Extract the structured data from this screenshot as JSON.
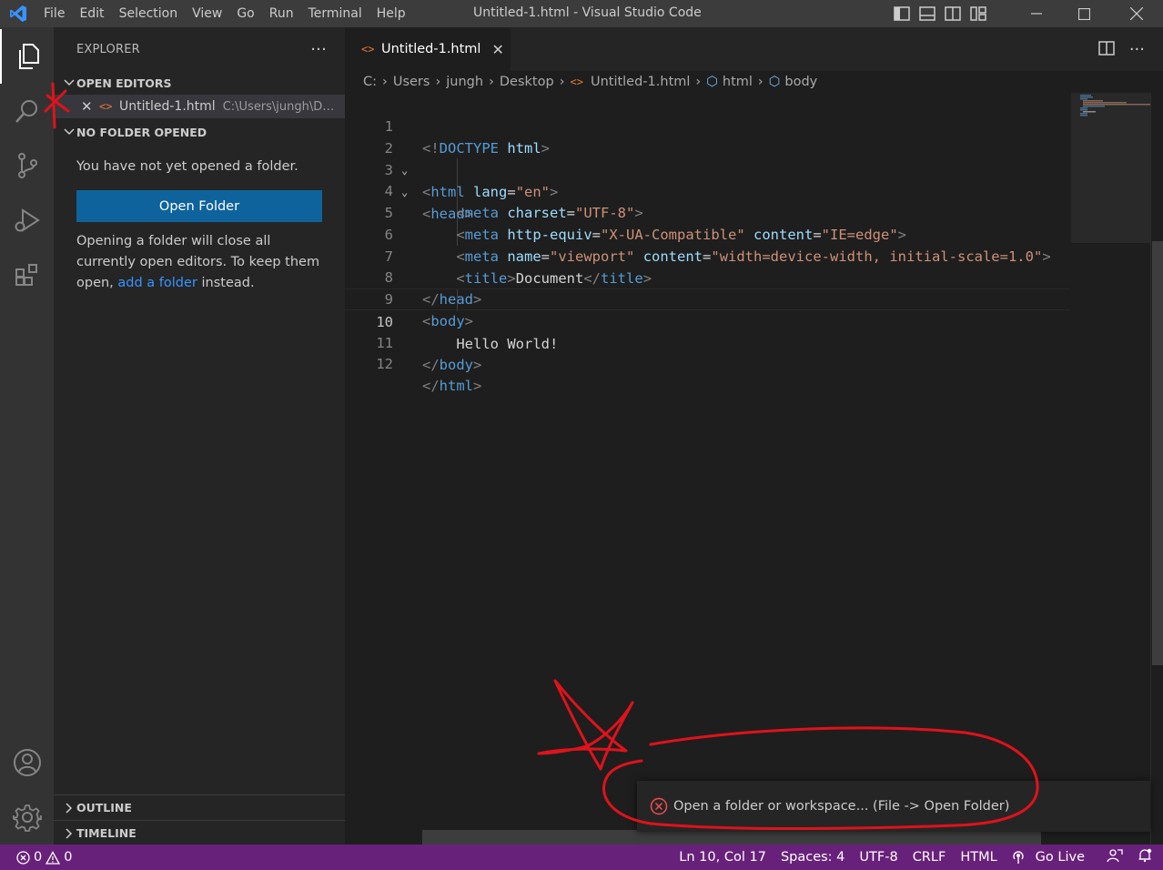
{
  "window": {
    "title": "Untitled-1.html - Visual Studio Code",
    "menu": [
      "File",
      "Edit",
      "Selection",
      "View",
      "Go",
      "Run",
      "Terminal",
      "Help"
    ]
  },
  "sidebar": {
    "title": "EXPLORER",
    "more": "···",
    "open_editors": {
      "label": "OPEN EDITORS",
      "file_name": "Untitled-1.html",
      "file_path": "C:\\Users\\jungh\\Desktop"
    },
    "no_folder": {
      "label": "NO FOLDER OPENED",
      "message": "You have not yet opened a folder.",
      "button": "Open Folder",
      "info_prefix": "Opening a folder will close all currently open editors. To keep them open,",
      "info_link": "add a folder",
      "info_suffix": "instead."
    },
    "outline": "OUTLINE",
    "timeline": "TIMELINE"
  },
  "editor": {
    "tab_label": "Untitled-1.html",
    "breadcrumb": [
      "C:",
      "Users",
      "jungh",
      "Desktop",
      "Untitled-1.html",
      "html",
      "body"
    ],
    "current_line": 10,
    "lines": [
      {
        "n": "1"
      },
      {
        "n": "2"
      },
      {
        "n": "3"
      },
      {
        "n": "4"
      },
      {
        "n": "5"
      },
      {
        "n": "6"
      },
      {
        "n": "7"
      },
      {
        "n": "8"
      },
      {
        "n": "9"
      },
      {
        "n": "10"
      },
      {
        "n": "11"
      },
      {
        "n": "12"
      }
    ]
  },
  "notification": {
    "message": "Open a folder or workspace... (File -> Open Folder)"
  },
  "statusbar": {
    "errors": "0",
    "warnings": "0",
    "position": "Ln 10, Col 17",
    "spaces": "Spaces: 4",
    "encoding": "UTF-8",
    "eol": "CRLF",
    "language": "HTML",
    "golive": "Go Live"
  },
  "colors": {
    "accent": "#0e639c",
    "statusbar": "#68217a",
    "annotation": "#e0121b"
  }
}
